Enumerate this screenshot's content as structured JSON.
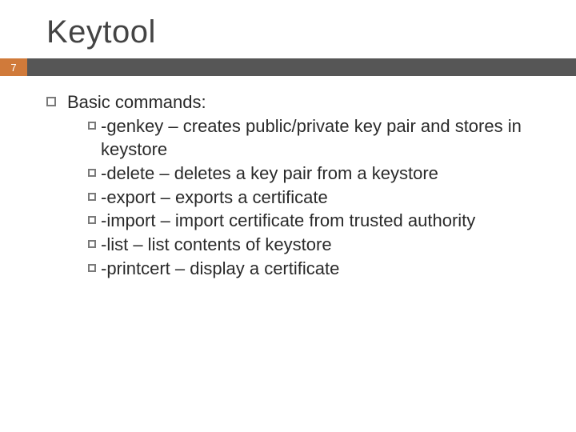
{
  "slide": {
    "title": "Keytool",
    "page_number": "7",
    "heading": "Basic commands:",
    "items": [
      {
        "cmd": "-genkey",
        "desc": " – creates public/private key pair and stores in keystore"
      },
      {
        "cmd": "-delete",
        "desc": " – deletes a key pair from a keystore"
      },
      {
        "cmd": "-export",
        "desc": " – exports a certificate"
      },
      {
        "cmd": "-import",
        "desc": " – import certificate from trusted authority"
      },
      {
        "cmd": "-list",
        "desc": " – list contents of keystore"
      },
      {
        "cmd": "-printcert",
        "desc": " – display a certificate"
      }
    ]
  }
}
